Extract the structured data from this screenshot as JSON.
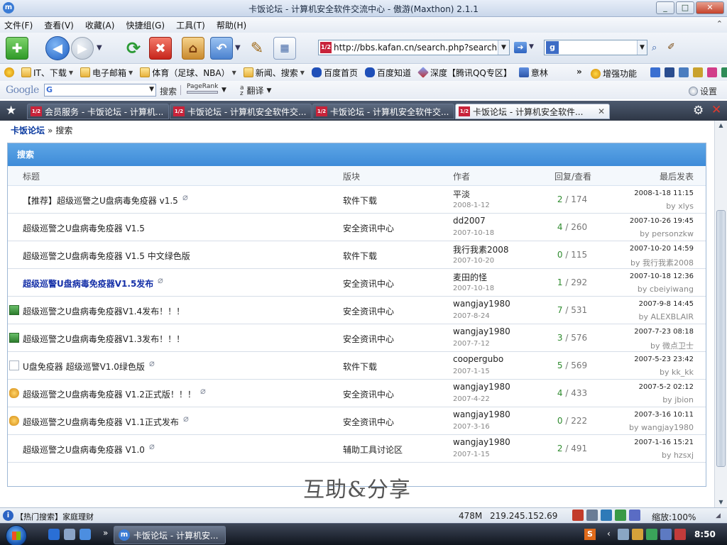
{
  "window": {
    "title": "卡饭论坛 - 计算机安全软件交流中心 - 傲游(Maxthon) 2.1.1",
    "app_icon": "m",
    "buttons": {
      "minimize": "_",
      "maximize": "□",
      "close": "✕"
    }
  },
  "menubar": {
    "items": [
      "文件(F)",
      "查看(V)",
      "收藏(A)",
      "快捷组(G)",
      "工具(T)",
      "帮助(H)"
    ],
    "chevron": "⌃"
  },
  "toolbar": {
    "new_icon": "✚",
    "back_icon": "◀",
    "forward_icon": "▶",
    "dropdown_glyph": "▼",
    "refresh_icon": "⟳",
    "stop_icon": "✖",
    "home_icon": "⌂",
    "undo_icon": "↶",
    "pen_icon": "✎",
    "grid_icon": "▦",
    "address_favicon": "1/2",
    "address_url": "http://bbs.kafan.cn/search.php?searchid=9",
    "go_icon": "➜",
    "search_engine_icon": "g",
    "search_go_icon": "⌕",
    "search_extra_icon": "✐"
  },
  "favbar": {
    "items": [
      {
        "label": "",
        "icon": "star-icon"
      },
      {
        "label": "IT、下载",
        "icon": "folder-icon"
      },
      {
        "label": "电子邮箱",
        "icon": "folder-icon"
      },
      {
        "label": "体育（足球、NBA）",
        "icon": "folder-icon"
      },
      {
        "label": "新闻、搜索",
        "icon": "folder-icon"
      },
      {
        "label": "百度首页",
        "icon": "paw-icon"
      },
      {
        "label": "百度知道",
        "icon": "paw-icon"
      },
      {
        "label": "深度【腾讯QQ专区】",
        "icon": "diamond-icon"
      },
      {
        "label": "意林",
        "icon": "book-icon"
      }
    ],
    "more": "»",
    "enhance_label": "增强功能"
  },
  "googlebar": {
    "logo": "Google",
    "g_icon": "G",
    "search_label": "搜索",
    "pagerank_label": "PageRank",
    "translate_label": "翻译",
    "translate_glyph": "a\nz",
    "settings_label": "设置"
  },
  "tabs": [
    {
      "title": "会员服务 - 卡饭论坛 - 计算机...",
      "active": false
    },
    {
      "title": "卡饭论坛 - 计算机安全软件交...",
      "active": false
    },
    {
      "title": "卡饭论坛 - 计算机安全软件交...",
      "active": false
    },
    {
      "title": "卡饭论坛 - 计算机安全软件...",
      "active": true
    }
  ],
  "tabbar": {
    "star": "★",
    "gear": "⚙",
    "close_all": "✕",
    "tab_close": "✕"
  },
  "page": {
    "breadcrumb": {
      "home": "卡饭论坛",
      "sep": "»",
      "current": "搜索"
    },
    "box_title": "搜索",
    "columns": {
      "title": "标题",
      "forum": "版块",
      "author": "作者",
      "stats": "回复/查看",
      "last": "最后发表"
    },
    "clip_icon": "⌀",
    "rows": [
      {
        "icon": "",
        "title": "【推荐】超级巡警之U盘病毒免疫器 v1.5",
        "highlight": false,
        "clip": true,
        "forum": "软件下载",
        "author": "平淡",
        "date": "2008-1-12",
        "replies": "2",
        "views": "174",
        "last_time": "2008-1-18 11:15",
        "last_by": "by xlys"
      },
      {
        "icon": "",
        "title": "超级巡警之U盘病毒免疫器 V1.5",
        "highlight": false,
        "clip": false,
        "forum": "安全资讯中心",
        "author": "dd2007",
        "date": "2007-10-18",
        "replies": "4",
        "views": "260",
        "last_time": "2007-10-26 19:45",
        "last_by": "by personzkw"
      },
      {
        "icon": "",
        "title": "超级巡警之U盘病毒免疫器 V1.5 中文绿色版",
        "highlight": false,
        "clip": false,
        "forum": "软件下载",
        "author": "我行我素2008",
        "date": "2007-10-20",
        "replies": "0",
        "views": "115",
        "last_time": "2007-10-20 14:59",
        "last_by": "by 我行我素2008"
      },
      {
        "icon": "",
        "title": "超级巡警U盘病毒免疫器V1.5发布",
        "highlight": true,
        "clip": true,
        "forum": "安全资讯中心",
        "author": "麦田的怪",
        "date": "2007-10-18",
        "replies": "1",
        "views": "292",
        "last_time": "2007-10-18 12:36",
        "last_by": "by cbeiyiwang"
      },
      {
        "icon": "image-icon",
        "title": "超级巡警之U盘病毒免疫器V1.4发布！！！",
        "highlight": false,
        "clip": false,
        "forum": "安全资讯中心",
        "author": "wangjay1980",
        "date": "2007-8-24",
        "replies": "7",
        "views": "531",
        "last_time": "2007-9-8 14:45",
        "last_by": "by ALEXBLAIR"
      },
      {
        "icon": "image-icon",
        "title": "超级巡警之U盘病毒免疫器V1.3发布！！！",
        "highlight": false,
        "clip": false,
        "forum": "安全资讯中心",
        "author": "wangjay1980",
        "date": "2007-7-12",
        "replies": "3",
        "views": "576",
        "last_time": "2007-7-23 08:18",
        "last_by": "by 微点卫士"
      },
      {
        "icon": "document-icon",
        "title": "U盘免疫器 超级巡警V1.0绿色版",
        "highlight": false,
        "clip": true,
        "forum": "软件下载",
        "author": "coopergubo",
        "date": "2007-1-15",
        "replies": "5",
        "views": "569",
        "last_time": "2007-5-23 23:42",
        "last_by": "by kk_kk"
      },
      {
        "icon": "hand-icon",
        "title": "超级巡警之U盘病毒免疫器 V1.2正式版！！！",
        "highlight": false,
        "clip": true,
        "forum": "安全资讯中心",
        "author": "wangjay1980",
        "date": "2007-4-22",
        "replies": "4",
        "views": "433",
        "last_time": "2007-5-2 02:12",
        "last_by": "by jbion"
      },
      {
        "icon": "hand-icon",
        "title": "超级巡警之U盘病毒免疫器 V1.1正式发布",
        "highlight": false,
        "clip": true,
        "forum": "安全资讯中心",
        "author": "wangjay1980",
        "date": "2007-3-16",
        "replies": "0",
        "views": "222",
        "last_time": "2007-3-16 10:11",
        "last_by": "by wangjay1980"
      },
      {
        "icon": "",
        "title": "超级巡警之U盘病毒免疫器 V1.0",
        "highlight": false,
        "clip": true,
        "forum": "辅助工具讨论区",
        "author": "wangjay1980",
        "date": "2007-1-15",
        "replies": "2",
        "views": "491",
        "last_time": "2007-1-16 15:21",
        "last_by": "by hzsxj"
      }
    ],
    "slogan": "互助&分享"
  },
  "statusbar": {
    "info_icon": "i",
    "text": "【热门搜索】家庭理财",
    "memory": "478M",
    "ip": "219.245.152.69",
    "zoom": "缩放:100%"
  },
  "taskbar": {
    "quick_more": "»",
    "task_item": "卡饭论坛 - 计算机安...",
    "task_icon": "m",
    "tray_s": "S",
    "tray_arrow": "‹",
    "clock": "8:50"
  },
  "colors": {
    "box_header": "#4a97de",
    "link_blue": "#0a3aa0",
    "reply_green": "#2e8b2e",
    "tabbar_bg": "#3a4456"
  }
}
